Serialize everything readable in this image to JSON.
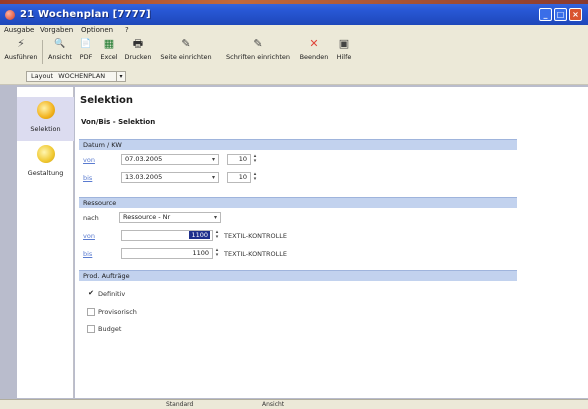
{
  "window": {
    "title": "21 Wochenplan [7777]",
    "controls": {
      "minimize": "_",
      "maximize": "□",
      "close": "×"
    }
  },
  "menu": [
    "Ausgabe",
    "Vorgaben",
    "Optionen",
    "?"
  ],
  "toolbar": [
    {
      "label": "Ausführen",
      "icon": "run-icon",
      "glyph": "⚡"
    },
    {
      "label": "Ansicht",
      "icon": "preview-icon",
      "glyph": "🔍"
    },
    {
      "label": "PDF",
      "icon": "pdf-icon",
      "glyph": "📄"
    },
    {
      "label": "Excel",
      "icon": "excel-icon",
      "glyph": "▦"
    },
    {
      "label": "Drucken",
      "icon": "printer-icon",
      "glyph": "🖶"
    },
    {
      "label": "Seite einrichten",
      "icon": "page-setup-icon",
      "glyph": "✎"
    },
    {
      "label": "Schriften einrichten",
      "icon": "font-setup-icon",
      "glyph": "✎"
    },
    {
      "label": "Beenden",
      "icon": "exit-icon",
      "glyph": "✕"
    },
    {
      "label": "Hilfe",
      "icon": "help-icon",
      "glyph": "▣"
    }
  ],
  "layout": {
    "label": "Layout",
    "value": "WOCHENPLAN"
  },
  "nav": [
    {
      "label": "Selektion",
      "icon": "selection-icon",
      "active": true
    },
    {
      "label": "Gestaltung",
      "icon": "design-icon",
      "active": false
    }
  ],
  "main": {
    "title": "Selektion",
    "subtitle": "Von/Bis - Selektion",
    "datum": {
      "header": "Datum / KW",
      "von_label": "von",
      "von_date": "07.03.2005",
      "von_kw": "10",
      "bis_label": "bis",
      "bis_date": "13.03.2005",
      "bis_kw": "10"
    },
    "ressource": {
      "header": "Ressource",
      "nach_label": "nach",
      "nach_value": "Ressource - Nr",
      "von_label": "von",
      "von_value": "1100",
      "von_desc": "TEXTIL-KONTROLLE",
      "bis_label": "bis",
      "bis_value": "1100",
      "bis_desc": "TEXTIL-KONTROLLE"
    },
    "auftraege": {
      "header": "Prod. Aufträge",
      "options": [
        {
          "label": "Definitiv",
          "checked": true
        },
        {
          "label": "Provisorisch",
          "checked": false
        },
        {
          "label": "Budget",
          "checked": false
        }
      ]
    }
  },
  "status": {
    "left": "Standard",
    "right": "Ansicht"
  }
}
